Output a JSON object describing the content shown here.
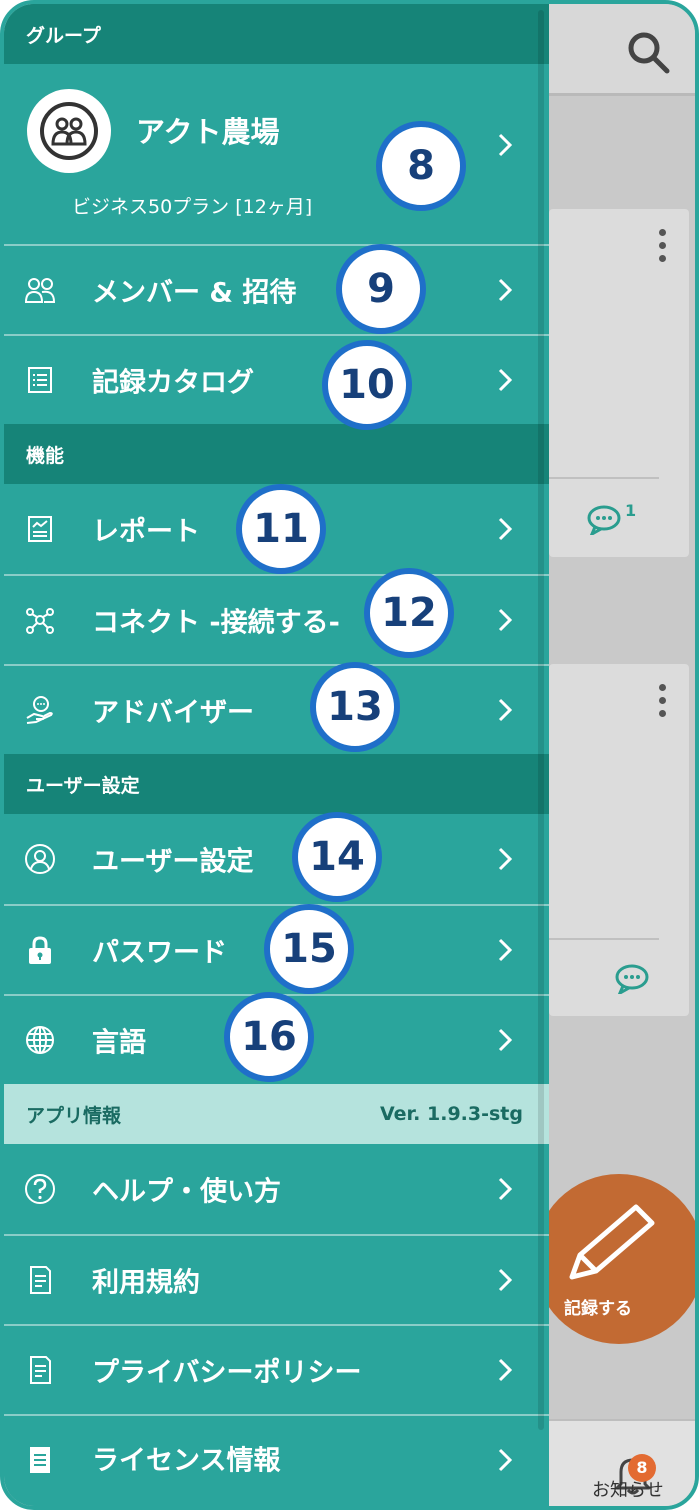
{
  "drawer": {
    "section_group": "グループ",
    "group_name": "アクト農場",
    "group_plan": "ビジネス50プラン [12ヶ月]",
    "items_group": [
      {
        "label": "メンバー & 招待"
      },
      {
        "label": "記録カタログ"
      }
    ],
    "section_features": "機能",
    "items_features": [
      {
        "label": "レポート"
      },
      {
        "label": "コネクト -接続する-"
      },
      {
        "label": "アドバイザー"
      }
    ],
    "section_user": "ユーザー設定",
    "items_user": [
      {
        "label": "ユーザー設定"
      },
      {
        "label": "パスワード"
      },
      {
        "label": "言語"
      }
    ],
    "section_app": "アプリ情報",
    "app_version": "Ver. 1.9.3-stg",
    "items_app": [
      {
        "label": "ヘルプ・使い方"
      },
      {
        "label": "利用規約"
      },
      {
        "label": "プライバシーポリシー"
      },
      {
        "label": "ライセンス情報"
      }
    ]
  },
  "badges": [
    "8",
    "9",
    "10",
    "11",
    "12",
    "13",
    "14",
    "15",
    "16"
  ],
  "background": {
    "comment_count": "1",
    "fab_label": "記録する",
    "notification_count": "8",
    "notification_label": "お知らせ"
  },
  "colors": {
    "drawer": "#2aa59c",
    "section_header": "#168478",
    "app_info_header": "#b5e3dd",
    "badge_border": "#1f6fc9",
    "fab": "#c26a33",
    "notification_badge": "#e36b32"
  }
}
